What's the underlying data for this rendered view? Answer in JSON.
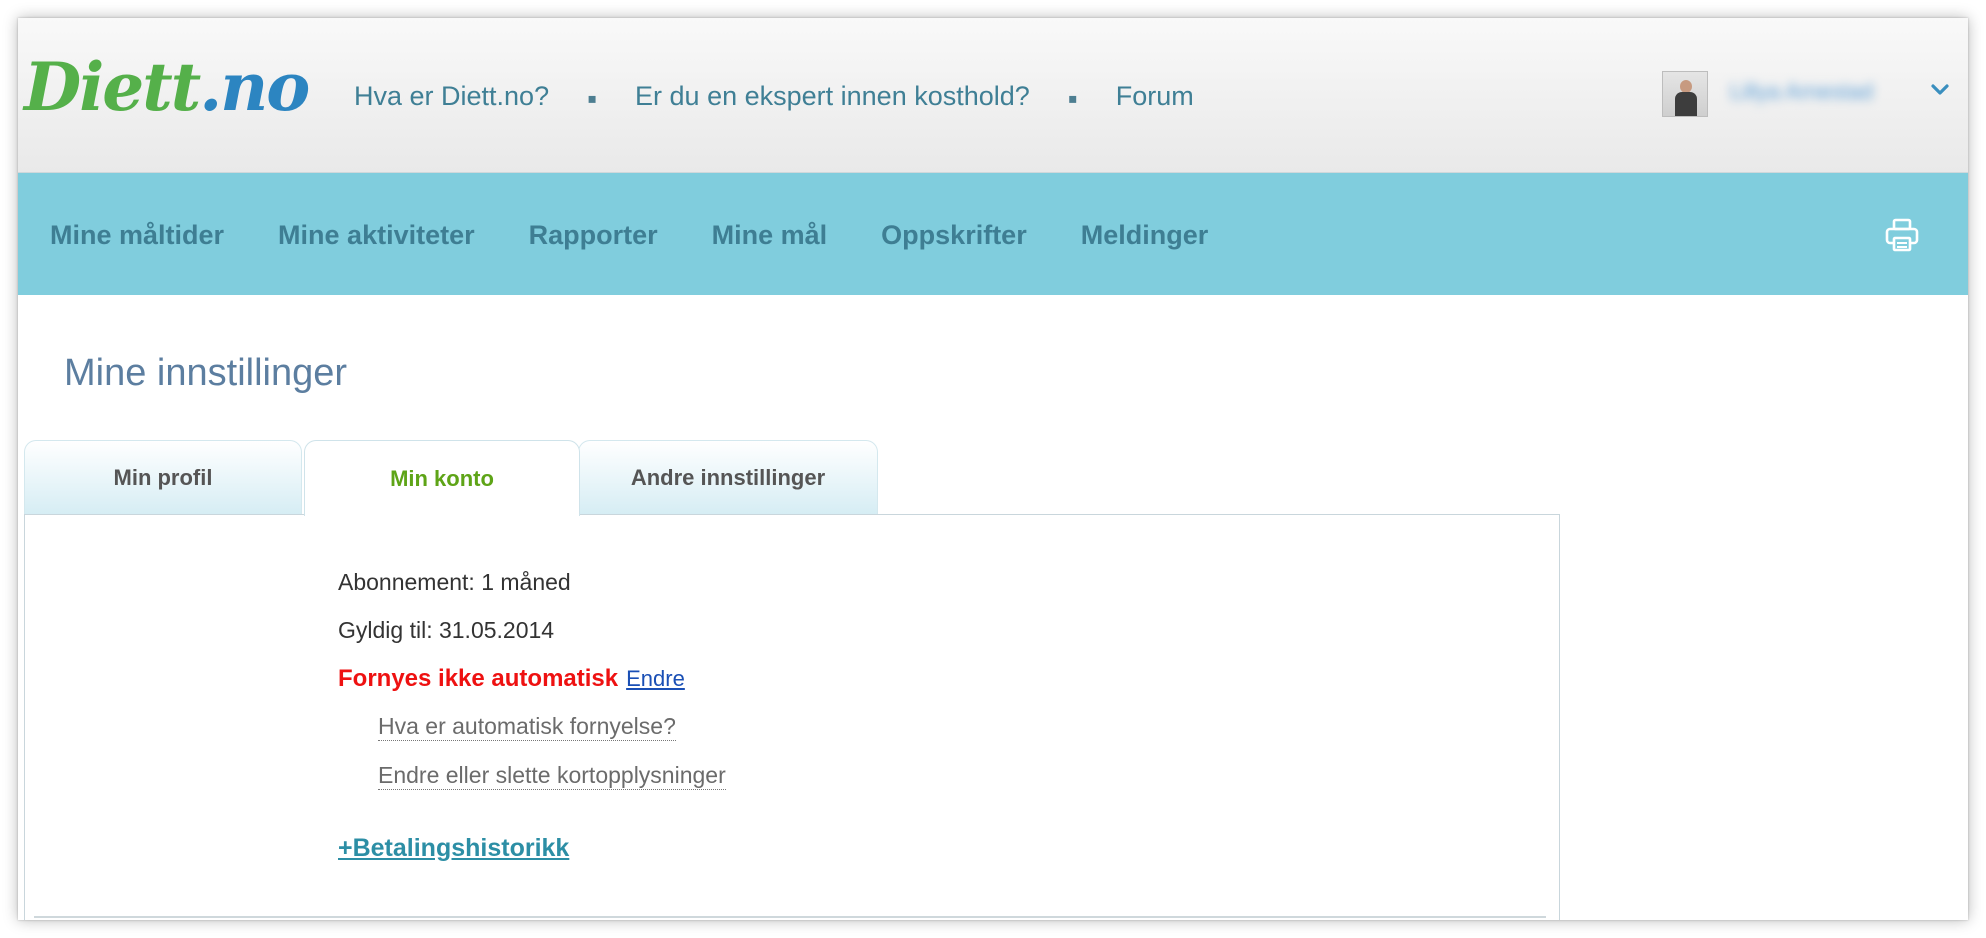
{
  "header": {
    "logo_part1": "Diett",
    "logo_part2": ".no",
    "links": [
      "Hva er Diett.no?",
      "Er du en ekspert innen kosthold?",
      "Forum"
    ],
    "separator": "▪",
    "user_name": "Lillya Arnestad"
  },
  "nav": {
    "items": [
      "Mine måltider",
      "Mine aktiviteter",
      "Rapporter",
      "Mine mål",
      "Oppskrifter",
      "Meldinger"
    ]
  },
  "page": {
    "title": "Mine innstillinger"
  },
  "tabs": [
    {
      "label": "Min profil"
    },
    {
      "label": "Min konto"
    },
    {
      "label": "Andre innstillinger"
    }
  ],
  "account": {
    "subscription": "Abonnement: 1 måned",
    "valid_until": "Gyldig til: 31.05.2014",
    "renewal_status": "Fornyes ikke automatisk",
    "change_link": "Endre",
    "what_is_renewal": "Hva er automatisk fornyelse?",
    "edit_card": "Endre eller slette kortopplysninger",
    "payment_history": "+Betalingshistorikk"
  },
  "colors": {
    "nav_bg": "#80cddd",
    "nav_text": "#3e7e93",
    "active_tab": "#5ea417",
    "warning": "#ee1111",
    "link": "#1a4fb5"
  },
  "icons": {
    "user_menu": "chevron-down-icon",
    "print": "printer-icon"
  }
}
